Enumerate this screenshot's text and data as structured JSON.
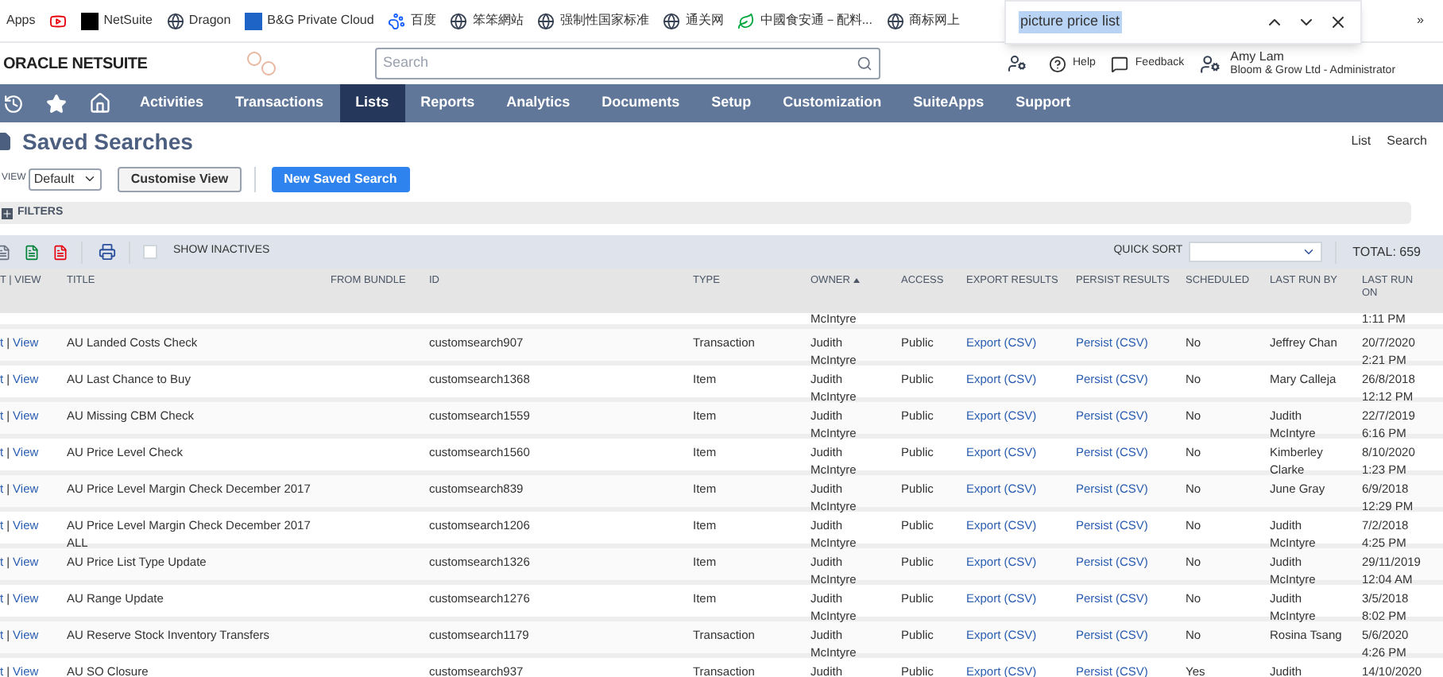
{
  "bookmarks": [
    {
      "label": "Apps"
    },
    {
      "kind": "youtube"
    },
    {
      "kind": "netsuite",
      "label": "NetSuite"
    },
    {
      "kind": "globe",
      "label": "Dragon"
    },
    {
      "kind": "dsm",
      "label": "B&G Private Cloud"
    },
    {
      "kind": "paw",
      "label": "百度"
    },
    {
      "kind": "globe",
      "label": "笨笨網站"
    },
    {
      "kind": "globe",
      "label": "强制性国家标准"
    },
    {
      "kind": "globe",
      "label": "通关网"
    },
    {
      "kind": "leaf",
      "label": "中國食安通－配料..."
    },
    {
      "kind": "globe",
      "label": "商标网上"
    }
  ],
  "bookmarks_more": "»",
  "find_bar": {
    "value": "picture price list"
  },
  "header": {
    "logo": "ORACLE NETSUITE",
    "search": {
      "placeholder": "Search"
    },
    "help": "Help",
    "feedback": "Feedback",
    "user_name": "Amy Lam",
    "user_role": "Bloom & Grow Ltd - Administrator"
  },
  "nav": [
    {
      "label": "Activities",
      "selected": false
    },
    {
      "label": "Transactions",
      "selected": false
    },
    {
      "label": "Lists",
      "selected": true
    },
    {
      "label": "Reports",
      "selected": false
    },
    {
      "label": "Analytics",
      "selected": false
    },
    {
      "label": "Documents",
      "selected": false
    },
    {
      "label": "Setup",
      "selected": false
    },
    {
      "label": "Customization",
      "selected": false
    },
    {
      "label": "SuiteApps",
      "selected": false
    },
    {
      "label": "Support",
      "selected": false
    }
  ],
  "page_title": "Saved Searches",
  "page_links": [
    "List",
    "Search"
  ],
  "view_label": "VIEW",
  "view_select": "Default",
  "customise_button": "Customise View",
  "new_button": "New Saved Search",
  "filters_label": "FILTERS",
  "toolbar": {
    "show_inactives": {
      "label": "SHOW INACTIVES",
      "checked": false
    },
    "quick_sort_label": "QUICK SORT",
    "total": "TOTAL: 659"
  },
  "columns": [
    {
      "label": "T | VIEW",
      "sorted": false
    },
    {
      "label": "TITLE",
      "sorted": false
    },
    {
      "label": "FROM BUNDLE",
      "sorted": false
    },
    {
      "label": "ID",
      "sorted": false
    },
    {
      "label": "TYPE",
      "sorted": false
    },
    {
      "label": "OWNER",
      "sorted": true
    },
    {
      "label": "ACCESS",
      "sorted": false
    },
    {
      "label": "EXPORT RESULTS",
      "sorted": false
    },
    {
      "label": "PERSIST RESULTS",
      "sorted": false
    },
    {
      "label": "SCHEDULED",
      "sorted": false
    },
    {
      "label": "LAST RUN BY",
      "sorted": false
    },
    {
      "label": "LAST RUN ON",
      "sorted": false
    }
  ],
  "partial_row": {
    "owner": "McIntyre",
    "last_run_on": "1:11 PM"
  },
  "rows": [
    {
      "edit": "t",
      "view": "View",
      "sep": "|",
      "title": "AU Landed Costs Check",
      "id": "customsearch907",
      "type": "Transaction",
      "owner": "Judith McIntyre",
      "access": "Public",
      "export": "Export (CSV)",
      "persist": "Persist (CSV)",
      "scheduled": "No",
      "last_run_by": "Jeffrey Chan",
      "last_run_on": "20/7/2020 2:21 PM"
    },
    {
      "edit": "t",
      "view": "View",
      "sep": "|",
      "title": "AU Last Chance to Buy",
      "id": "customsearch1368",
      "type": "Item",
      "owner": "Judith McIntyre",
      "access": "Public",
      "export": "Export (CSV)",
      "persist": "Persist (CSV)",
      "scheduled": "No",
      "last_run_by": "Mary Calleja",
      "last_run_on": "26/8/2018 12:12 PM"
    },
    {
      "edit": "t",
      "view": "View",
      "sep": "|",
      "title": "AU Missing CBM Check",
      "id": "customsearch1559",
      "type": "Item",
      "owner": "Judith McIntyre",
      "access": "Public",
      "export": "Export (CSV)",
      "persist": "Persist (CSV)",
      "scheduled": "No",
      "last_run_by": "Judith McIntyre",
      "last_run_on": "22/7/2019 6:16 PM"
    },
    {
      "edit": "t",
      "view": "View",
      "sep": "|",
      "title": "AU Price Level Check",
      "id": "customsearch1560",
      "type": "Item",
      "owner": "Judith McIntyre",
      "access": "Public",
      "export": "Export (CSV)",
      "persist": "Persist (CSV)",
      "scheduled": "No",
      "last_run_by": "Kimberley Clarke",
      "last_run_on": "8/10/2020 1:23 PM"
    },
    {
      "edit": "t",
      "view": "View",
      "sep": "|",
      "title": "AU Price Level Margin Check December 2017",
      "id": "customsearch839",
      "type": "Item",
      "owner": "Judith McIntyre",
      "access": "Public",
      "export": "Export (CSV)",
      "persist": "Persist (CSV)",
      "scheduled": "No",
      "last_run_by": "June Gray",
      "last_run_on": "6/9/2018 12:29 PM"
    },
    {
      "edit": "t",
      "view": "View",
      "sep": "|",
      "title": "AU Price Level Margin Check December 2017 ALL",
      "id": "customsearch1206",
      "type": "Item",
      "owner": "Judith McIntyre",
      "access": "Public",
      "export": "Export (CSV)",
      "persist": "Persist (CSV)",
      "scheduled": "No",
      "last_run_by": "Judith McIntyre",
      "last_run_on": "7/2/2018 4:25 PM"
    },
    {
      "edit": "t",
      "view": "View",
      "sep": "|",
      "title": "AU Price List Type Update",
      "id": "customsearch1326",
      "type": "Item",
      "owner": "Judith McIntyre",
      "access": "Public",
      "export": "Export (CSV)",
      "persist": "Persist (CSV)",
      "scheduled": "No",
      "last_run_by": "Judith McIntyre",
      "last_run_on": "29/11/2019 12:04 AM"
    },
    {
      "edit": "t",
      "view": "View",
      "sep": "|",
      "title": "AU Range Update",
      "id": "customsearch1276",
      "type": "Item",
      "owner": "Judith McIntyre",
      "access": "Public",
      "export": "Export (CSV)",
      "persist": "Persist (CSV)",
      "scheduled": "No",
      "last_run_by": "Judith McIntyre",
      "last_run_on": "3/5/2018 8:02 PM"
    },
    {
      "edit": "t",
      "view": "View",
      "sep": "|",
      "title": "AU Reserve Stock Inventory Transfers",
      "id": "customsearch1179",
      "type": "Transaction",
      "owner": "Judith McIntyre",
      "access": "Public",
      "export": "Export (CSV)",
      "persist": "Persist (CSV)",
      "scheduled": "No",
      "last_run_by": "Rosina Tsang",
      "last_run_on": "5/6/2020 4:26 PM"
    },
    {
      "edit": "t",
      "view": "View",
      "sep": "|",
      "title": "AU SO Closure",
      "id": "customsearch937",
      "type": "Transaction",
      "owner": "Judith",
      "access": "Public",
      "export": "Export (CSV)",
      "persist": "Persist (CSV)",
      "scheduled": "Yes",
      "last_run_by": "Judith",
      "last_run_on": "14/10/2020"
    }
  ]
}
